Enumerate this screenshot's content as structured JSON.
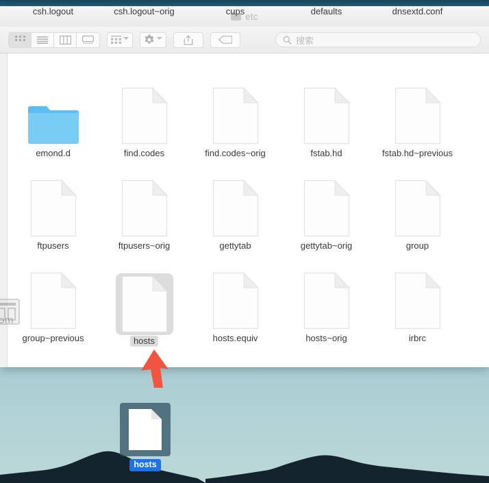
{
  "window": {
    "title": "etc",
    "title_icon": "folder-icon"
  },
  "toolbar": {
    "view_modes": [
      {
        "name": "icon-view",
        "icon": "grid-icon",
        "active": true
      },
      {
        "name": "list-view",
        "icon": "list-icon",
        "active": false
      },
      {
        "name": "column-view",
        "icon": "columns-icon",
        "active": false
      },
      {
        "name": "coverflow-view",
        "icon": "coverflow-icon",
        "active": false
      }
    ],
    "arrange_button": {
      "name": "arrange-by-button",
      "icon": "grid-small-icon"
    },
    "action_button": {
      "name": "action-gear-button",
      "icon": "gear-icon"
    },
    "share_button": {
      "name": "share-button",
      "icon": "share-icon"
    },
    "tag_button": {
      "name": "tag-button",
      "icon": "tag-icon"
    },
    "search": {
      "placeholder": "搜索",
      "value": "",
      "icon": "search-icon"
    }
  },
  "files": {
    "rows": [
      {
        "labels_only": true,
        "items": [
          {
            "label": "csh.logout",
            "type": "file",
            "selected": false
          },
          {
            "label": "csh.logout~orig",
            "type": "file",
            "selected": false
          },
          {
            "label": "cups",
            "type": "folder",
            "selected": false
          },
          {
            "label": "defaults",
            "type": "folder",
            "selected": false
          },
          {
            "label": "dnsextd.conf",
            "type": "file",
            "selected": false
          }
        ]
      },
      {
        "labels_only": false,
        "items": [
          {
            "label": "emond.d",
            "type": "folder",
            "selected": false
          },
          {
            "label": "find.codes",
            "type": "file",
            "selected": false
          },
          {
            "label": "find.codes~orig",
            "type": "file",
            "selected": false
          },
          {
            "label": "fstab.hd",
            "type": "file",
            "selected": false
          },
          {
            "label": "fstab.hd~previous",
            "type": "file",
            "selected": false
          }
        ]
      },
      {
        "labels_only": false,
        "items": [
          {
            "label": "ftpusers",
            "type": "file",
            "selected": false
          },
          {
            "label": "ftpusers~orig",
            "type": "file",
            "selected": false
          },
          {
            "label": "gettytab",
            "type": "file",
            "selected": false
          },
          {
            "label": "gettytab~orig",
            "type": "file",
            "selected": false
          },
          {
            "label": "group",
            "type": "file",
            "selected": false
          }
        ]
      },
      {
        "labels_only": false,
        "items": [
          {
            "label": "group~previous",
            "type": "file",
            "selected": false
          },
          {
            "label": "hosts",
            "type": "file",
            "selected": true
          },
          {
            "label": "hosts.equiv",
            "type": "file",
            "selected": false
          },
          {
            "label": "hosts~orig",
            "type": "file",
            "selected": false
          },
          {
            "label": "irbrc",
            "type": "file",
            "selected": false
          }
        ]
      }
    ]
  },
  "watermark": {
    "text": "com",
    "icon": "watermark-icon"
  },
  "annotation": {
    "name": "red-arrow-pointer",
    "color": "#f1553f"
  },
  "desktop": {
    "file": {
      "label": "hosts",
      "icon": "file-icon",
      "selected": true
    },
    "label_highlight_color": "#1e72e8",
    "sky_top_color": "#1d4f68",
    "sky_bottom_color": "#bcd8d8",
    "mountain_color": "#13242f"
  }
}
